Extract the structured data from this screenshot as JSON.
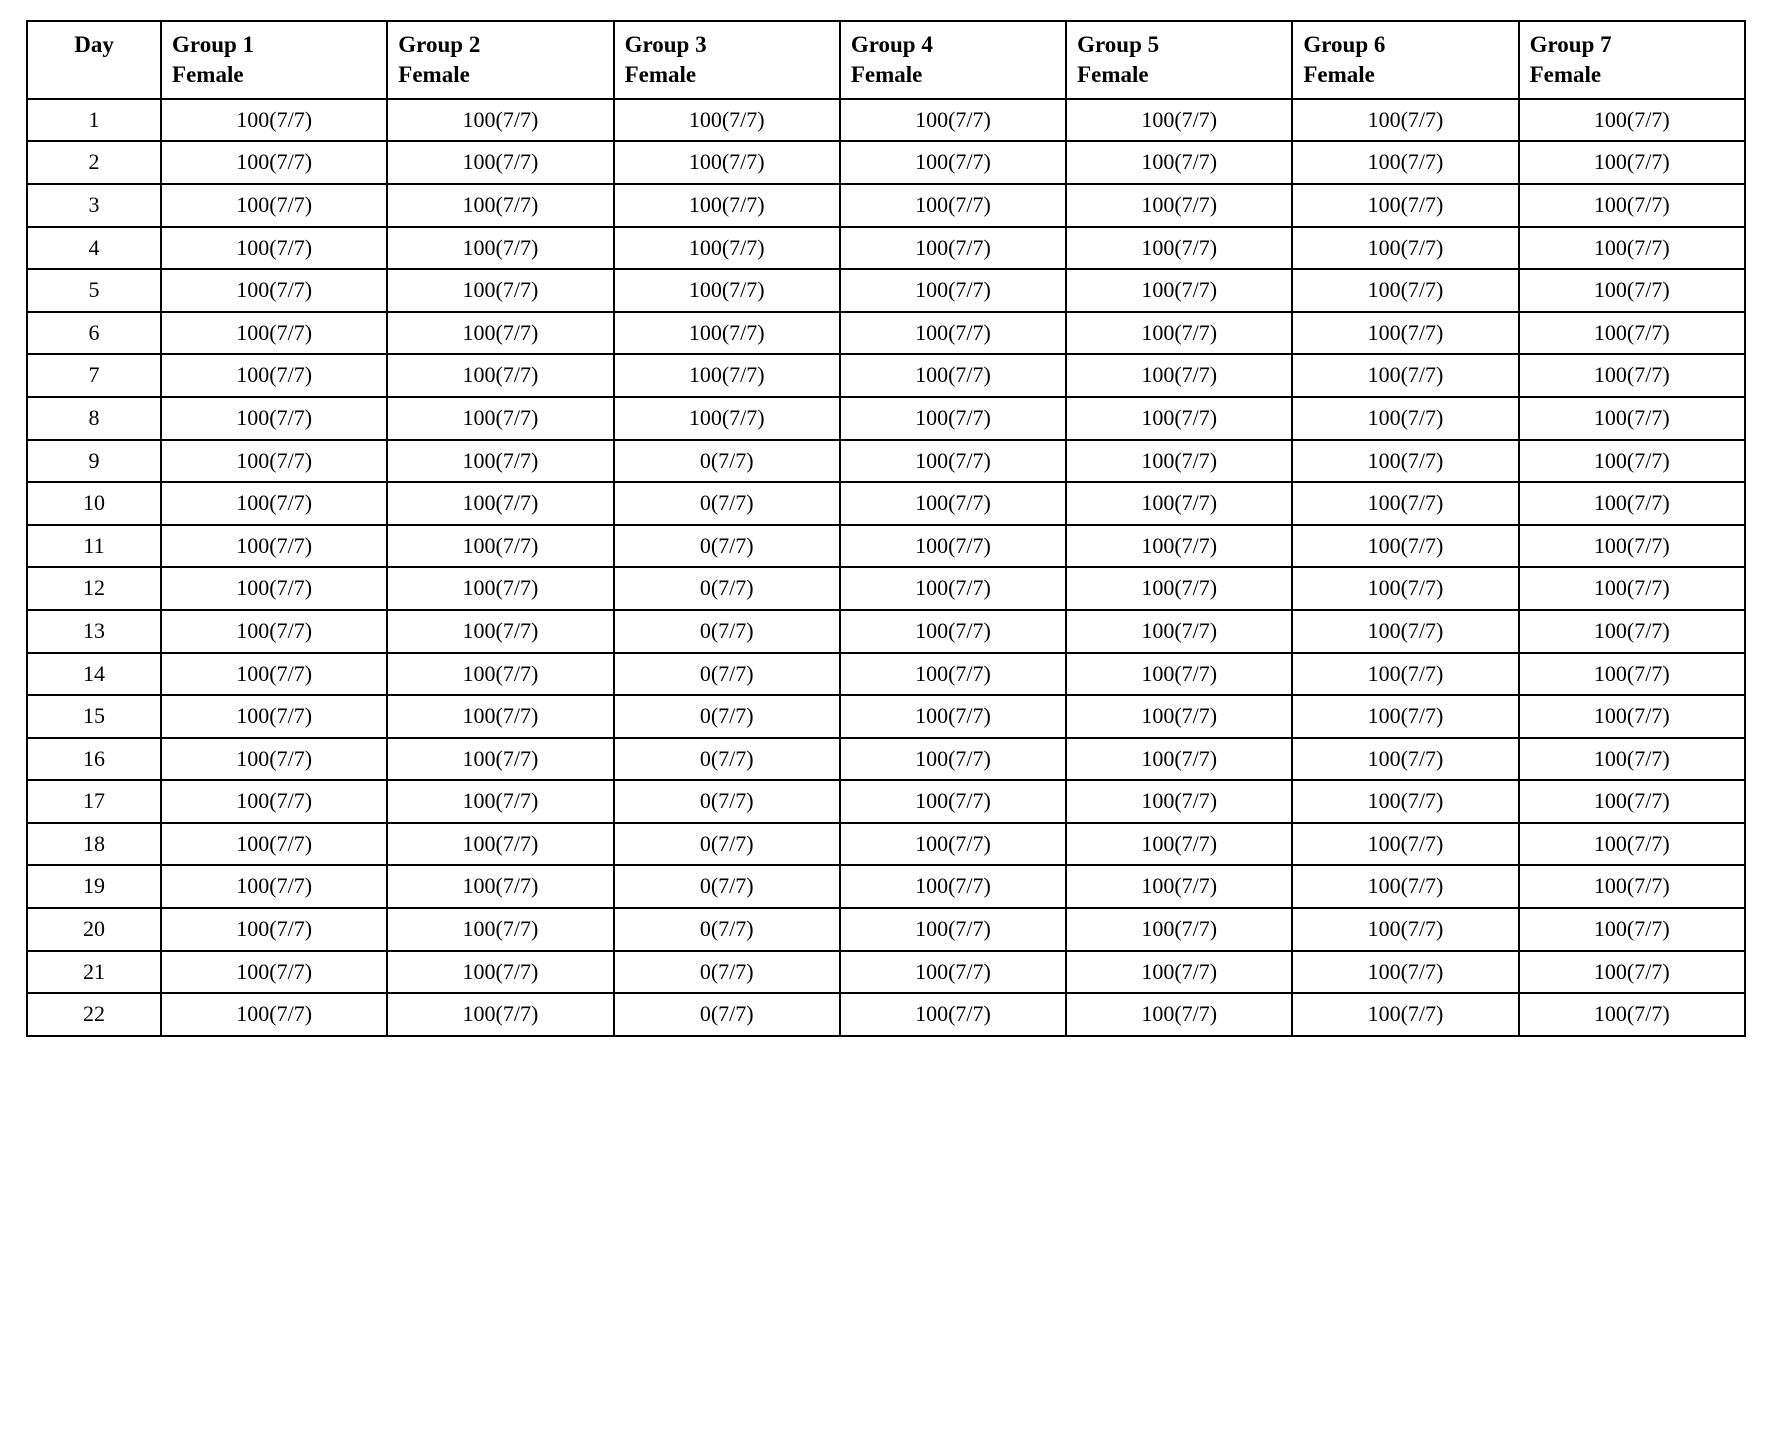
{
  "table": {
    "headers": [
      "Day",
      "Group 1\nFemale",
      "Group 2\nFemale",
      "Group 3\nFemale",
      "Group 4\nFemale",
      "Group 5\nFemale",
      "Group 6\nFemale",
      "Group 7\nFemale"
    ],
    "rows": [
      {
        "day": "1",
        "g1": "100(7/7)",
        "g2": "100(7/7)",
        "g3": "100(7/7)",
        "g4": "100(7/7)",
        "g5": "100(7/7)",
        "g6": "100(7/7)",
        "g7": "100(7/7)"
      },
      {
        "day": "2",
        "g1": "100(7/7)",
        "g2": "100(7/7)",
        "g3": "100(7/7)",
        "g4": "100(7/7)",
        "g5": "100(7/7)",
        "g6": "100(7/7)",
        "g7": "100(7/7)"
      },
      {
        "day": "3",
        "g1": "100(7/7)",
        "g2": "100(7/7)",
        "g3": "100(7/7)",
        "g4": "100(7/7)",
        "g5": "100(7/7)",
        "g6": "100(7/7)",
        "g7": "100(7/7)"
      },
      {
        "day": "4",
        "g1": "100(7/7)",
        "g2": "100(7/7)",
        "g3": "100(7/7)",
        "g4": "100(7/7)",
        "g5": "100(7/7)",
        "g6": "100(7/7)",
        "g7": "100(7/7)"
      },
      {
        "day": "5",
        "g1": "100(7/7)",
        "g2": "100(7/7)",
        "g3": "100(7/7)",
        "g4": "100(7/7)",
        "g5": "100(7/7)",
        "g6": "100(7/7)",
        "g7": "100(7/7)"
      },
      {
        "day": "6",
        "g1": "100(7/7)",
        "g2": "100(7/7)",
        "g3": "100(7/7)",
        "g4": "100(7/7)",
        "g5": "100(7/7)",
        "g6": "100(7/7)",
        "g7": "100(7/7)"
      },
      {
        "day": "7",
        "g1": "100(7/7)",
        "g2": "100(7/7)",
        "g3": "100(7/7)",
        "g4": "100(7/7)",
        "g5": "100(7/7)",
        "g6": "100(7/7)",
        "g7": "100(7/7)"
      },
      {
        "day": "8",
        "g1": "100(7/7)",
        "g2": "100(7/7)",
        "g3": "100(7/7)",
        "g4": "100(7/7)",
        "g5": "100(7/7)",
        "g6": "100(7/7)",
        "g7": "100(7/7)"
      },
      {
        "day": "9",
        "g1": "100(7/7)",
        "g2": "100(7/7)",
        "g3": "0(7/7)",
        "g4": "100(7/7)",
        "g5": "100(7/7)",
        "g6": "100(7/7)",
        "g7": "100(7/7)"
      },
      {
        "day": "10",
        "g1": "100(7/7)",
        "g2": "100(7/7)",
        "g3": "0(7/7)",
        "g4": "100(7/7)",
        "g5": "100(7/7)",
        "g6": "100(7/7)",
        "g7": "100(7/7)"
      },
      {
        "day": "11",
        "g1": "100(7/7)",
        "g2": "100(7/7)",
        "g3": "0(7/7)",
        "g4": "100(7/7)",
        "g5": "100(7/7)",
        "g6": "100(7/7)",
        "g7": "100(7/7)"
      },
      {
        "day": "12",
        "g1": "100(7/7)",
        "g2": "100(7/7)",
        "g3": "0(7/7)",
        "g4": "100(7/7)",
        "g5": "100(7/7)",
        "g6": "100(7/7)",
        "g7": "100(7/7)"
      },
      {
        "day": "13",
        "g1": "100(7/7)",
        "g2": "100(7/7)",
        "g3": "0(7/7)",
        "g4": "100(7/7)",
        "g5": "100(7/7)",
        "g6": "100(7/7)",
        "g7": "100(7/7)"
      },
      {
        "day": "14",
        "g1": "100(7/7)",
        "g2": "100(7/7)",
        "g3": "0(7/7)",
        "g4": "100(7/7)",
        "g5": "100(7/7)",
        "g6": "100(7/7)",
        "g7": "100(7/7)"
      },
      {
        "day": "15",
        "g1": "100(7/7)",
        "g2": "100(7/7)",
        "g3": "0(7/7)",
        "g4": "100(7/7)",
        "g5": "100(7/7)",
        "g6": "100(7/7)",
        "g7": "100(7/7)"
      },
      {
        "day": "16",
        "g1": "100(7/7)",
        "g2": "100(7/7)",
        "g3": "0(7/7)",
        "g4": "100(7/7)",
        "g5": "100(7/7)",
        "g6": "100(7/7)",
        "g7": "100(7/7)"
      },
      {
        "day": "17",
        "g1": "100(7/7)",
        "g2": "100(7/7)",
        "g3": "0(7/7)",
        "g4": "100(7/7)",
        "g5": "100(7/7)",
        "g6": "100(7/7)",
        "g7": "100(7/7)"
      },
      {
        "day": "18",
        "g1": "100(7/7)",
        "g2": "100(7/7)",
        "g3": "0(7/7)",
        "g4": "100(7/7)",
        "g5": "100(7/7)",
        "g6": "100(7/7)",
        "g7": "100(7/7)"
      },
      {
        "day": "19",
        "g1": "100(7/7)",
        "g2": "100(7/7)",
        "g3": "0(7/7)",
        "g4": "100(7/7)",
        "g5": "100(7/7)",
        "g6": "100(7/7)",
        "g7": "100(7/7)"
      },
      {
        "day": "20",
        "g1": "100(7/7)",
        "g2": "100(7/7)",
        "g3": "0(7/7)",
        "g4": "100(7/7)",
        "g5": "100(7/7)",
        "g6": "100(7/7)",
        "g7": "100(7/7)"
      },
      {
        "day": "21",
        "g1": "100(7/7)",
        "g2": "100(7/7)",
        "g3": "0(7/7)",
        "g4": "100(7/7)",
        "g5": "100(7/7)",
        "g6": "100(7/7)",
        "g7": "100(7/7)"
      },
      {
        "day": "22",
        "g1": "100(7/7)",
        "g2": "100(7/7)",
        "g3": "0(7/7)",
        "g4": "100(7/7)",
        "g5": "100(7/7)",
        "g6": "100(7/7)",
        "g7": "100(7/7)"
      }
    ]
  }
}
